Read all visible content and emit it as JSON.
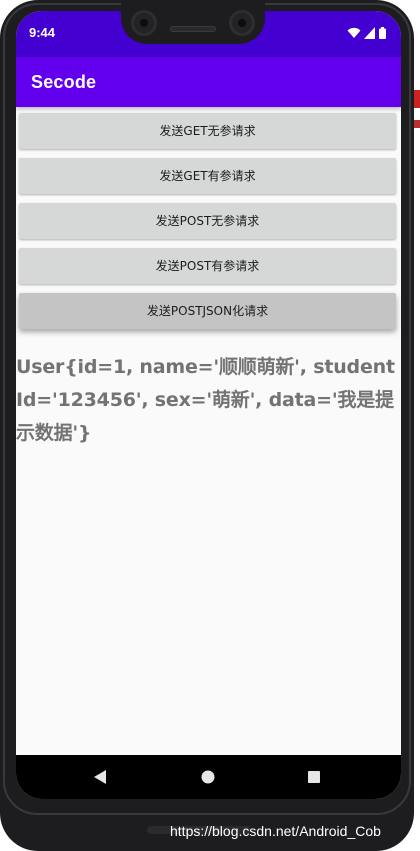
{
  "status_bar": {
    "time": "9:44"
  },
  "app_bar": {
    "title": "Secode"
  },
  "buttons": [
    {
      "label": "发送GET无参请求"
    },
    {
      "label": "发送GET有参请求"
    },
    {
      "label": "发送POST无参请求"
    },
    {
      "label": "发送POST有参请求"
    },
    {
      "label": "发送POSTJSON化请求"
    }
  ],
  "result": {
    "text": "User{id=1, name='顺顺萌新', studentId='123456', sex='萌新', data='我是提示数据'}"
  },
  "nav_bar": {
    "icons": [
      "back-triangle-icon",
      "home-circle-icon",
      "recents-square-icon"
    ]
  },
  "watermark": {
    "text": "https://blog.csdn.net/Android_Cob"
  },
  "colors": {
    "status_bar": "#4400d0",
    "app_bar": "#6200ee",
    "button_bg": "#d6d7d7",
    "result_text": "#737373"
  }
}
